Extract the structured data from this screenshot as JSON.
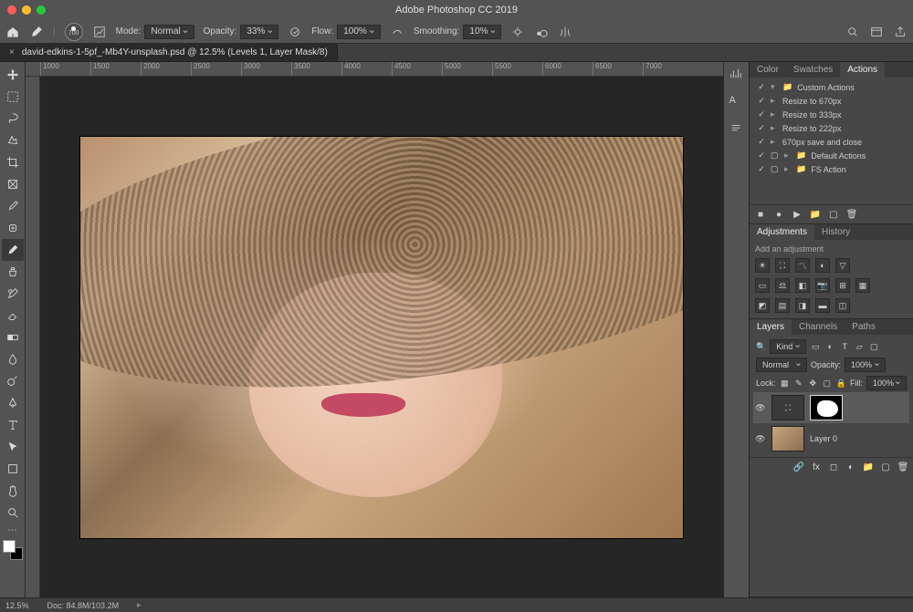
{
  "app_title": "Adobe Photoshop CC 2019",
  "document_tab": "david-edkins-1-5pf_-Mb4Y-unsplash.psd @ 12.5% (Levels 1, Layer Mask/8)",
  "options": {
    "brush_size": "700",
    "mode_label": "Mode:",
    "mode_value": "Normal",
    "opacity_label": "Opacity:",
    "opacity_value": "33%",
    "flow_label": "Flow:",
    "flow_value": "100%",
    "smoothing_label": "Smoothing:",
    "smoothing_value": "10%"
  },
  "ruler_ticks": [
    "1000",
    "1500",
    "2000",
    "2500",
    "3000",
    "3500",
    "4000",
    "4500",
    "5000",
    "5500",
    "6000",
    "6500",
    "7000"
  ],
  "status_zoom": "12.5%",
  "status_doc": "Doc: 84.8M/103.2M",
  "panels": {
    "actions": {
      "tabs": [
        "Color",
        "Swatches",
        "Actions"
      ],
      "active_tab": 2,
      "set_name": "Custom Actions",
      "items": [
        "Resize to 670px",
        "Resize to 333px",
        "Resize to 222px",
        "670px save and close"
      ],
      "folders": [
        "Default Actions",
        "FS Action"
      ]
    },
    "adjustments": {
      "tabs": [
        "Adjustments",
        "History"
      ],
      "active_tab": 0,
      "hint": "Add an adjustment"
    },
    "layers": {
      "tabs": [
        "Layers",
        "Channels",
        "Paths"
      ],
      "active_tab": 0,
      "kind_label": "Kind",
      "blend_mode": "Normal",
      "opacity_label": "Opacity:",
      "opacity_value": "100%",
      "lock_label": "Lock:",
      "fill_label": "Fill:",
      "fill_value": "100%",
      "layer1_name": "",
      "layer0_name": "Layer 0"
    }
  }
}
